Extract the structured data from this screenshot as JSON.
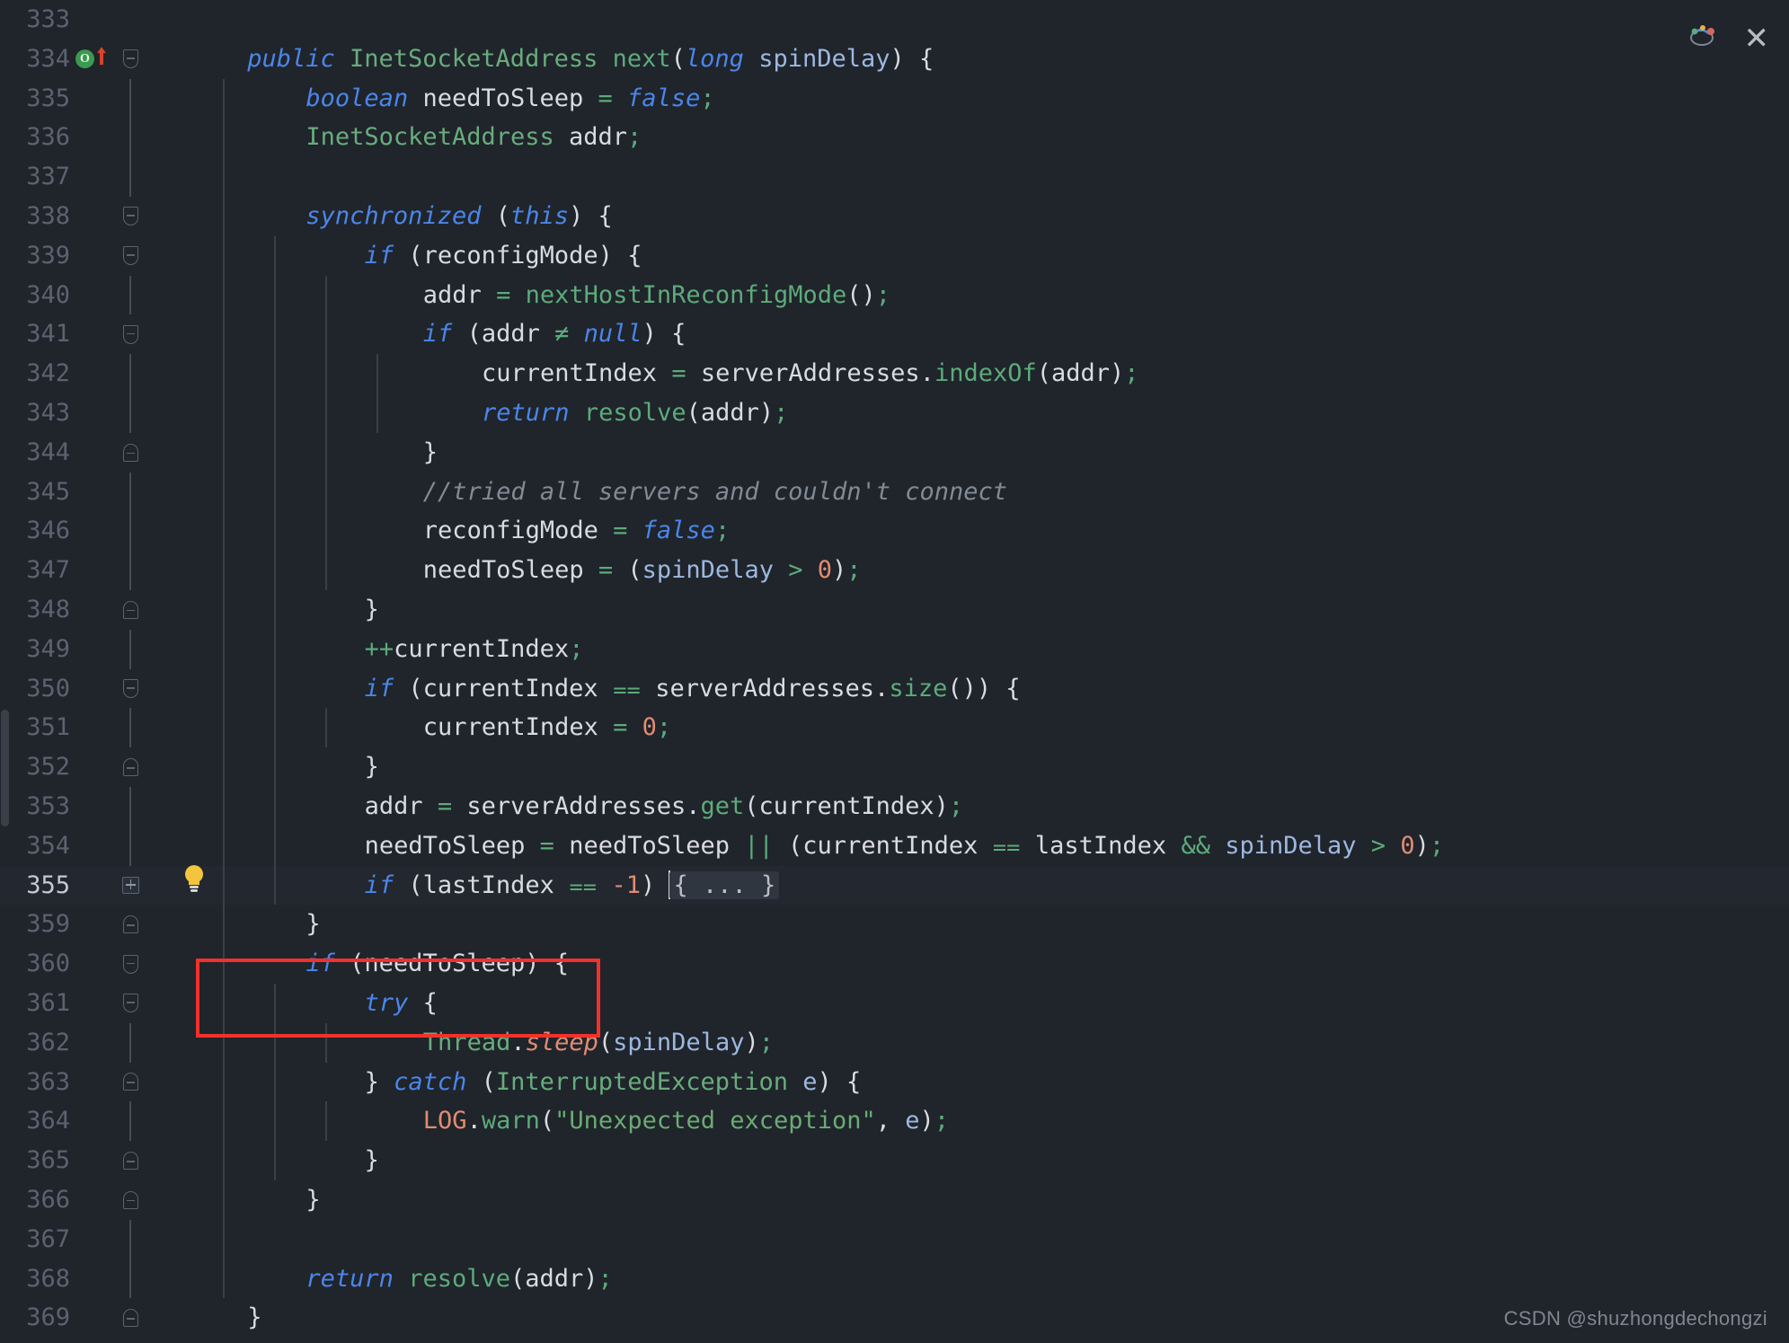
{
  "editor": {
    "theme_background": "#20242b",
    "current_line_background": "#23272f",
    "annotation_box_color": "#f2312a",
    "watermark": "CSDN @shuzhongdechongzi",
    "close_label": "✕",
    "gutter_override_marker": "O",
    "fold_placeholder": "{ ... }"
  },
  "lines": [
    {
      "no": "333",
      "text": ""
    },
    {
      "no": "334",
      "text": "    public InetSocketAddress next(long spinDelay) {"
    },
    {
      "no": "335",
      "text": "        boolean needToSleep = false;"
    },
    {
      "no": "336",
      "text": "        InetSocketAddress addr;"
    },
    {
      "no": "337",
      "text": ""
    },
    {
      "no": "338",
      "text": "        synchronized (this) {"
    },
    {
      "no": "339",
      "text": "            if (reconfigMode) {"
    },
    {
      "no": "340",
      "text": "                addr = nextHostInReconfigMode();"
    },
    {
      "no": "341",
      "text": "                if (addr != null) {"
    },
    {
      "no": "342",
      "text": "                    currentIndex = serverAddresses.indexOf(addr);"
    },
    {
      "no": "343",
      "text": "                    return resolve(addr);"
    },
    {
      "no": "344",
      "text": "                }"
    },
    {
      "no": "345",
      "text": "                //tried all servers and couldn't connect"
    },
    {
      "no": "346",
      "text": "                reconfigMode = false;"
    },
    {
      "no": "347",
      "text": "                needToSleep = (spinDelay > 0);"
    },
    {
      "no": "348",
      "text": "            }"
    },
    {
      "no": "349",
      "text": "            ++currentIndex;"
    },
    {
      "no": "350",
      "text": "            if (currentIndex == serverAddresses.size()) {"
    },
    {
      "no": "351",
      "text": "                currentIndex = 0;"
    },
    {
      "no": "352",
      "text": "            }"
    },
    {
      "no": "353",
      "text": "            addr = serverAddresses.get(currentIndex);"
    },
    {
      "no": "354",
      "text": "            needToSleep = needToSleep || (currentIndex == lastIndex && spinDelay > 0);"
    },
    {
      "no": "355",
      "text": "            if (lastIndex == -1) { ... }"
    },
    {
      "no": "359",
      "text": "        }"
    },
    {
      "no": "360",
      "text": "        if (needToSleep) {"
    },
    {
      "no": "361",
      "text": "            try {"
    },
    {
      "no": "362",
      "text": "                Thread.sleep(spinDelay);"
    },
    {
      "no": "363",
      "text": "            } catch (InterruptedException e) {"
    },
    {
      "no": "364",
      "text": "                LOG.warn(\"Unexpected exception\", e);"
    },
    {
      "no": "365",
      "text": "            }"
    },
    {
      "no": "366",
      "text": "        }"
    },
    {
      "no": "367",
      "text": ""
    },
    {
      "no": "368",
      "text": "        return resolve(addr);"
    },
    {
      "no": "369",
      "text": "    }"
    }
  ],
  "tokens": {
    "l334": [
      [
        "kw",
        "public"
      ],
      [
        "pnk",
        " "
      ],
      [
        "cls",
        "InetSocketAddress"
      ],
      [
        "pnk",
        " "
      ],
      [
        "fn",
        "next"
      ],
      [
        "pnk",
        "("
      ],
      [
        "kw",
        "long"
      ],
      [
        "pnk",
        " "
      ],
      [
        "par",
        "spinDelay"
      ],
      [
        "pnk",
        ") {"
      ]
    ],
    "l335": [
      [
        "kw",
        "boolean"
      ],
      [
        "pnk",
        " needToSleep "
      ],
      [
        "op",
        "="
      ],
      [
        "pnk",
        " "
      ],
      [
        "kw",
        "false"
      ],
      [
        "op",
        ";"
      ]
    ],
    "l336": [
      [
        "cls",
        "InetSocketAddress"
      ],
      [
        "pnk",
        " addr"
      ],
      [
        "op",
        ";"
      ]
    ],
    "l338": [
      [
        "kw",
        "synchronized"
      ],
      [
        "pnk",
        " ("
      ],
      [
        "kw",
        "this"
      ],
      [
        "pnk",
        ") {"
      ]
    ],
    "l339": [
      [
        "kw",
        "if"
      ],
      [
        "pnk",
        " (reconfigMode) {"
      ]
    ],
    "l340": [
      [
        "pnk",
        "addr "
      ],
      [
        "op",
        "="
      ],
      [
        "pnk",
        " "
      ],
      [
        "fn",
        "nextHostInReconfigMode"
      ],
      [
        "pnk",
        "()"
      ],
      [
        "op",
        ";"
      ]
    ],
    "l341": [
      [
        "kw",
        "if"
      ],
      [
        "pnk",
        " (addr "
      ],
      [
        "op",
        "≠"
      ],
      [
        "pnk",
        " "
      ],
      [
        "kw",
        "null"
      ],
      [
        "pnk",
        ") {"
      ]
    ],
    "l342": [
      [
        "pnk",
        "currentIndex "
      ],
      [
        "op",
        "="
      ],
      [
        "pnk",
        " serverAddresses"
      ],
      [
        "pnk",
        "."
      ],
      [
        "fn",
        "indexOf"
      ],
      [
        "pnk",
        "(addr)"
      ],
      [
        "op",
        ";"
      ]
    ],
    "l343": [
      [
        "kw",
        "return"
      ],
      [
        "pnk",
        " "
      ],
      [
        "fn",
        "resolve"
      ],
      [
        "pnk",
        "(addr)"
      ],
      [
        "op",
        ";"
      ]
    ],
    "l345": [
      [
        "cmt",
        "//tried all servers and couldn't connect"
      ]
    ],
    "l346": [
      [
        "pnk",
        "reconfigMode "
      ],
      [
        "op",
        "="
      ],
      [
        "pnk",
        " "
      ],
      [
        "kw",
        "false"
      ],
      [
        "op",
        ";"
      ]
    ],
    "l347": [
      [
        "pnk",
        "needToSleep "
      ],
      [
        "op",
        "="
      ],
      [
        "pnk",
        " ("
      ],
      [
        "par",
        "spinDelay"
      ],
      [
        "pnk",
        " "
      ],
      [
        "op",
        ">"
      ],
      [
        "pnk",
        " "
      ],
      [
        "num",
        "0"
      ],
      [
        "pnk",
        ")"
      ],
      [
        "op",
        ";"
      ]
    ],
    "l349": [
      [
        "op",
        "++"
      ],
      [
        "pnk",
        "currentIndex"
      ],
      [
        "op",
        ";"
      ]
    ],
    "l350": [
      [
        "kw",
        "if"
      ],
      [
        "pnk",
        " (currentIndex "
      ],
      [
        "op",
        "⩵"
      ],
      [
        "pnk",
        " serverAddresses"
      ],
      [
        "pnk",
        "."
      ],
      [
        "fn",
        "size"
      ],
      [
        "pnk",
        "()) {"
      ]
    ],
    "l351": [
      [
        "pnk",
        "currentIndex "
      ],
      [
        "op",
        "="
      ],
      [
        "pnk",
        " "
      ],
      [
        "num",
        "0"
      ],
      [
        "op",
        ";"
      ]
    ],
    "l353": [
      [
        "pnk",
        "addr "
      ],
      [
        "op",
        "="
      ],
      [
        "pnk",
        " serverAddresses"
      ],
      [
        "pnk",
        "."
      ],
      [
        "fn",
        "get"
      ],
      [
        "pnk",
        "(currentIndex)"
      ],
      [
        "op",
        ";"
      ]
    ],
    "l354": [
      [
        "pnk",
        "needToSleep "
      ],
      [
        "op",
        "="
      ],
      [
        "pnk",
        " needToSleep "
      ],
      [
        "op",
        "||"
      ],
      [
        "pnk",
        " (currentIndex "
      ],
      [
        "op",
        "⩵"
      ],
      [
        "pnk",
        " lastIndex "
      ],
      [
        "op",
        "&&"
      ],
      [
        "pnk",
        " "
      ],
      [
        "par",
        "spinDelay"
      ],
      [
        "pnk",
        " "
      ],
      [
        "op",
        ">"
      ],
      [
        "pnk",
        " "
      ],
      [
        "num",
        "0"
      ],
      [
        "pnk",
        ")"
      ],
      [
        "op",
        ";"
      ]
    ],
    "l355": [
      [
        "kw",
        "if"
      ],
      [
        "pnk",
        " (lastIndex "
      ],
      [
        "op",
        "⩵"
      ],
      [
        "pnk",
        " "
      ],
      [
        "num",
        "-1"
      ],
      [
        "pnk",
        ") "
      ]
    ],
    "l360": [
      [
        "kw",
        "if"
      ],
      [
        "pnk",
        " (needToSleep) {"
      ]
    ],
    "l361": [
      [
        "kw",
        "try"
      ],
      [
        "pnk",
        " {"
      ]
    ],
    "l362": [
      [
        "cls",
        "Thread"
      ],
      [
        "pnk",
        "."
      ],
      [
        "st-m",
        "sleep"
      ],
      [
        "pnk",
        "("
      ],
      [
        "par",
        "spinDelay"
      ],
      [
        "pnk",
        ")"
      ],
      [
        "op",
        ";"
      ]
    ],
    "l363": [
      [
        "pnk",
        "} "
      ],
      [
        "kw",
        "catch"
      ],
      [
        "pnk",
        " ("
      ],
      [
        "cls",
        "InterruptedException"
      ],
      [
        "pnk",
        " "
      ],
      [
        "par",
        "e"
      ],
      [
        "pnk",
        ") {"
      ]
    ],
    "l364": [
      [
        "stf",
        "LOG"
      ],
      [
        "pnk",
        "."
      ],
      [
        "fn",
        "warn"
      ],
      [
        "pnk",
        "("
      ],
      [
        "str",
        "\"Unexpected exception\""
      ],
      [
        "pnk",
        ", "
      ],
      [
        "par",
        "e"
      ],
      [
        "pnk",
        ")"
      ],
      [
        "op",
        ";"
      ]
    ],
    "l368": [
      [
        "kw",
        "return"
      ],
      [
        "pnk",
        " "
      ],
      [
        "fn",
        "resolve"
      ],
      [
        "pnk",
        "(addr)"
      ],
      [
        "op",
        ";"
      ]
    ]
  }
}
